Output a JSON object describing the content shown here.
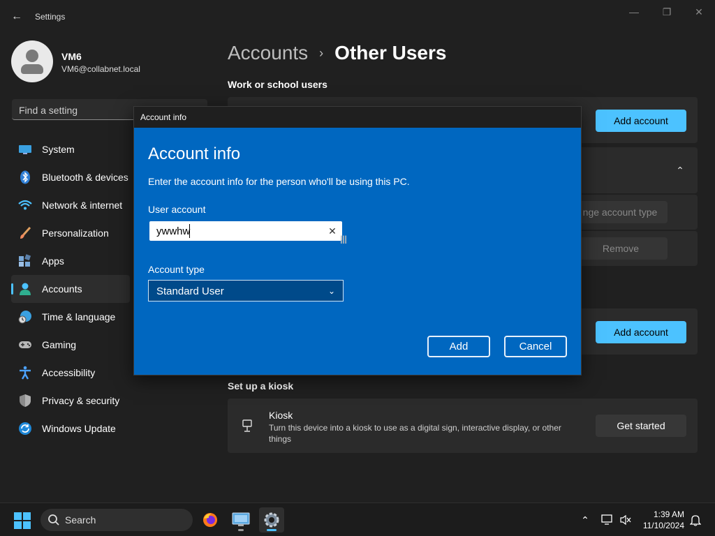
{
  "window": {
    "title": "Settings",
    "back_icon": "arrow-left-icon",
    "minimize_icon": "minimize-icon",
    "restore_icon": "restore-icon",
    "close_icon": "close-icon"
  },
  "profile": {
    "name": "VM6",
    "email": "VM6@collabnet.local"
  },
  "search": {
    "placeholder": "Find a setting"
  },
  "sidebar": {
    "items": [
      {
        "label": "System",
        "icon": "monitor-icon",
        "active": false
      },
      {
        "label": "Bluetooth & devices",
        "icon": "bluetooth-icon",
        "active": false
      },
      {
        "label": "Network & internet",
        "icon": "wifi-icon",
        "active": false
      },
      {
        "label": "Personalization",
        "icon": "brush-icon",
        "active": false
      },
      {
        "label": "Apps",
        "icon": "apps-icon",
        "active": false
      },
      {
        "label": "Accounts",
        "icon": "person-icon",
        "active": true
      },
      {
        "label": "Time & language",
        "icon": "clock-globe-icon",
        "active": false
      },
      {
        "label": "Gaming",
        "icon": "gamepad-icon",
        "active": false
      },
      {
        "label": "Accessibility",
        "icon": "accessibility-icon",
        "active": false
      },
      {
        "label": "Privacy & security",
        "icon": "shield-icon",
        "active": false
      },
      {
        "label": "Windows Update",
        "icon": "update-icon",
        "active": false
      }
    ]
  },
  "main": {
    "breadcrumb_parent": "Accounts",
    "breadcrumb_current": "Other Users",
    "work_school_title": "Work or school users",
    "add_account_label": "Add account",
    "change_account_type_label": "nge account type",
    "remove_label": "Remove",
    "add_account_label_2": "Add account",
    "kiosk_section_title": "Set up a kiosk",
    "kiosk_title": "Kiosk",
    "kiosk_description": "Turn this device into a kiosk to use as a digital sign, interactive display, or other things",
    "get_started_label": "Get started"
  },
  "dialog": {
    "window_title": "Account info",
    "heading": "Account info",
    "description": "Enter the account info for the person who'll be using this PC.",
    "user_account_label": "User account",
    "user_account_value": "ywwhw",
    "account_type_label": "Account type",
    "account_type_value": "Standard User",
    "add_label": "Add",
    "cancel_label": "Cancel"
  },
  "taskbar": {
    "search_label": "Search",
    "time": "1:39 AM",
    "date": "11/10/2024",
    "apps": [
      "firefox-icon",
      "remote-desktop-icon",
      "settings-gear-icon"
    ]
  },
  "colors": {
    "accent": "#4cc2ff",
    "dialog_bg": "#0067c0",
    "window_bg": "#202020"
  }
}
